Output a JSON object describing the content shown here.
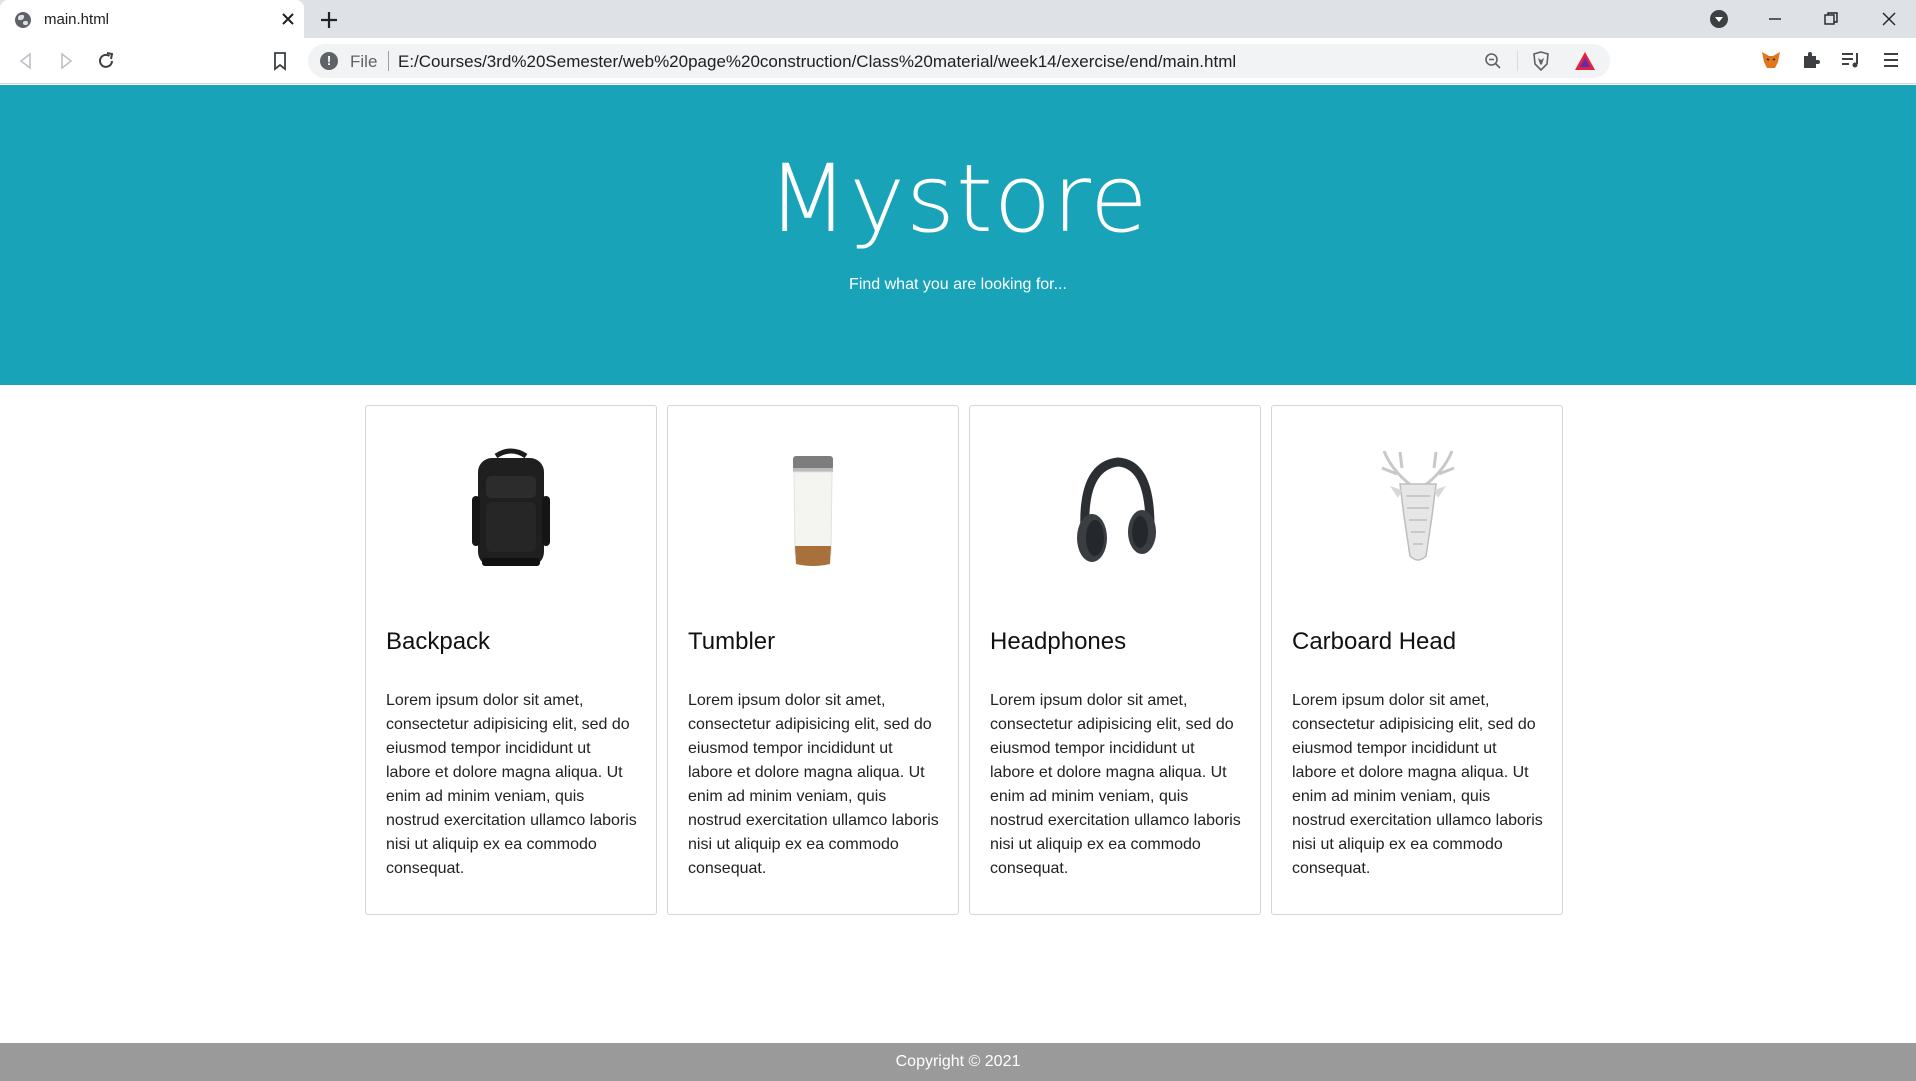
{
  "browser": {
    "tab_title": "main.html",
    "scheme": "File",
    "url": "E:/Courses/3rd%20Semester/web%20page%20construction/Class%20material/week14/exercise/end/main.html"
  },
  "hero": {
    "title": "Mystore",
    "subtitle": "Find what you are looking for..."
  },
  "products": [
    {
      "name": "Backpack",
      "image": "backpack-image",
      "description": "Lorem ipsum dolor sit amet, consectetur adipisicing elit, sed do eiusmod tempor incididunt ut labore et dolore magna aliqua. Ut enim ad minim veniam, quis nostrud exercitation ullamco laboris nisi ut aliquip ex ea commodo consequat."
    },
    {
      "name": "Tumbler",
      "image": "tumbler-image",
      "description": "Lorem ipsum dolor sit amet, consectetur adipisicing elit, sed do eiusmod tempor incididunt ut labore et dolore magna aliqua. Ut enim ad minim veniam, quis nostrud exercitation ullamco laboris nisi ut aliquip ex ea commodo consequat."
    },
    {
      "name": "Headphones",
      "image": "headphones-image",
      "description": "Lorem ipsum dolor sit amet, consectetur adipisicing elit, sed do eiusmod tempor incididunt ut labore et dolore magna aliqua. Ut enim ad minim veniam, quis nostrud exercitation ullamco laboris nisi ut aliquip ex ea commodo consequat."
    },
    {
      "name": "Carboard Head",
      "image": "deer-head-image",
      "description": "Lorem ipsum dolor sit amet, consectetur adipisicing elit, sed do eiusmod tempor incididunt ut labore et dolore magna aliqua. Ut enim ad minim veniam, quis nostrud exercitation ullamco laboris nisi ut aliquip ex ea commodo consequat."
    }
  ],
  "footer": {
    "text": "Copyright © 2021"
  },
  "colors": {
    "hero_background": "#18a3b8",
    "footer_background": "#9a9a9a",
    "tabstrip_background": "#dee1e6"
  }
}
